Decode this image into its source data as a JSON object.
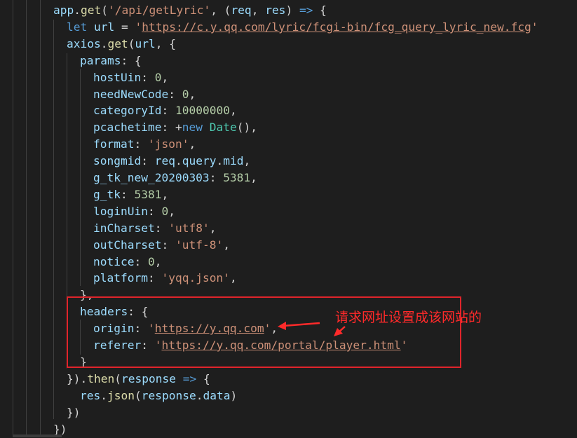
{
  "code_lines": [
    {
      "indent": 76,
      "tokens": [
        {
          "t": "app",
          "c": "var"
        },
        {
          "t": ".",
          "c": "pun"
        },
        {
          "t": "get",
          "c": "fn"
        },
        {
          "t": "(",
          "c": "pun"
        },
        {
          "t": "'/api/getLyric'",
          "c": "str"
        },
        {
          "t": ", (",
          "c": "pun"
        },
        {
          "t": "req",
          "c": "var"
        },
        {
          "t": ", ",
          "c": "pun"
        },
        {
          "t": "res",
          "c": "var"
        },
        {
          "t": ") ",
          "c": "pun"
        },
        {
          "t": "=>",
          "c": "kw"
        },
        {
          "t": " {",
          "c": "pun"
        }
      ]
    },
    {
      "indent": 95,
      "tokens": [
        {
          "t": "let",
          "c": "kw"
        },
        {
          "t": " ",
          "c": "pun"
        },
        {
          "t": "url",
          "c": "var"
        },
        {
          "t": " = ",
          "c": "pun"
        },
        {
          "t": "'",
          "c": "str"
        },
        {
          "t": "https://c.y.qq.com/lyric/fcgi-bin/fcg_query_lyric_new.fcg",
          "c": "str u"
        },
        {
          "t": "'",
          "c": "str"
        }
      ]
    },
    {
      "indent": 95,
      "tokens": [
        {
          "t": "axios",
          "c": "var"
        },
        {
          "t": ".",
          "c": "pun"
        },
        {
          "t": "get",
          "c": "fn"
        },
        {
          "t": "(",
          "c": "pun"
        },
        {
          "t": "url",
          "c": "var"
        },
        {
          "t": ", {",
          "c": "pun"
        }
      ]
    },
    {
      "indent": 114,
      "tokens": [
        {
          "t": "params",
          "c": "var"
        },
        {
          "t": ": {",
          "c": "pun"
        }
      ]
    },
    {
      "indent": 133,
      "tokens": [
        {
          "t": "hostUin",
          "c": "var"
        },
        {
          "t": ": ",
          "c": "pun"
        },
        {
          "t": "0",
          "c": "num"
        },
        {
          "t": ",",
          "c": "pun"
        }
      ]
    },
    {
      "indent": 133,
      "tokens": [
        {
          "t": "needNewCode",
          "c": "var"
        },
        {
          "t": ": ",
          "c": "pun"
        },
        {
          "t": "0",
          "c": "num"
        },
        {
          "t": ",",
          "c": "pun"
        }
      ]
    },
    {
      "indent": 133,
      "tokens": [
        {
          "t": "categoryId",
          "c": "var"
        },
        {
          "t": ": ",
          "c": "pun"
        },
        {
          "t": "10000000",
          "c": "num"
        },
        {
          "t": ",",
          "c": "pun"
        }
      ]
    },
    {
      "indent": 133,
      "tokens": [
        {
          "t": "pcachetime",
          "c": "var"
        },
        {
          "t": ": +",
          "c": "pun"
        },
        {
          "t": "new",
          "c": "kw"
        },
        {
          "t": " ",
          "c": "pun"
        },
        {
          "t": "Date",
          "c": "cls"
        },
        {
          "t": "(),",
          "c": "pun"
        }
      ]
    },
    {
      "indent": 133,
      "tokens": [
        {
          "t": "format",
          "c": "var"
        },
        {
          "t": ": ",
          "c": "pun"
        },
        {
          "t": "'json'",
          "c": "str"
        },
        {
          "t": ",",
          "c": "pun"
        }
      ]
    },
    {
      "indent": 133,
      "tokens": [
        {
          "t": "songmid",
          "c": "var"
        },
        {
          "t": ": ",
          "c": "pun"
        },
        {
          "t": "req",
          "c": "var"
        },
        {
          "t": ".",
          "c": "pun"
        },
        {
          "t": "query",
          "c": "var"
        },
        {
          "t": ".",
          "c": "pun"
        },
        {
          "t": "mid",
          "c": "var"
        },
        {
          "t": ",",
          "c": "pun"
        }
      ]
    },
    {
      "indent": 133,
      "tokens": [
        {
          "t": "g_tk_new_20200303",
          "c": "var"
        },
        {
          "t": ": ",
          "c": "pun"
        },
        {
          "t": "5381",
          "c": "num"
        },
        {
          "t": ",",
          "c": "pun"
        }
      ]
    },
    {
      "indent": 133,
      "tokens": [
        {
          "t": "g_tk",
          "c": "var"
        },
        {
          "t": ": ",
          "c": "pun"
        },
        {
          "t": "5381",
          "c": "num"
        },
        {
          "t": ",",
          "c": "pun"
        }
      ]
    },
    {
      "indent": 133,
      "tokens": [
        {
          "t": "loginUin",
          "c": "var"
        },
        {
          "t": ": ",
          "c": "pun"
        },
        {
          "t": "0",
          "c": "num"
        },
        {
          "t": ",",
          "c": "pun"
        }
      ]
    },
    {
      "indent": 133,
      "tokens": [
        {
          "t": "inCharset",
          "c": "var"
        },
        {
          "t": ": ",
          "c": "pun"
        },
        {
          "t": "'utf8'",
          "c": "str"
        },
        {
          "t": ",",
          "c": "pun"
        }
      ]
    },
    {
      "indent": 133,
      "tokens": [
        {
          "t": "outCharset",
          "c": "var"
        },
        {
          "t": ": ",
          "c": "pun"
        },
        {
          "t": "'utf-8'",
          "c": "str"
        },
        {
          "t": ",",
          "c": "pun"
        }
      ]
    },
    {
      "indent": 133,
      "tokens": [
        {
          "t": "notice",
          "c": "var"
        },
        {
          "t": ": ",
          "c": "pun"
        },
        {
          "t": "0",
          "c": "num"
        },
        {
          "t": ",",
          "c": "pun"
        }
      ]
    },
    {
      "indent": 133,
      "tokens": [
        {
          "t": "platform",
          "c": "var"
        },
        {
          "t": ": ",
          "c": "pun"
        },
        {
          "t": "'yqq.json'",
          "c": "str"
        },
        {
          "t": ",",
          "c": "pun"
        }
      ]
    },
    {
      "indent": 114,
      "tokens": [
        {
          "t": "},",
          "c": "pun"
        }
      ]
    },
    {
      "indent": 114,
      "tokens": [
        {
          "t": "headers",
          "c": "var"
        },
        {
          "t": ": {",
          "c": "pun"
        }
      ]
    },
    {
      "indent": 133,
      "tokens": [
        {
          "t": "origin",
          "c": "var"
        },
        {
          "t": ": ",
          "c": "pun"
        },
        {
          "t": "'",
          "c": "str"
        },
        {
          "t": "https://y.qq.com",
          "c": "str u"
        },
        {
          "t": "'",
          "c": "str"
        },
        {
          "t": ",",
          "c": "pun"
        }
      ]
    },
    {
      "indent": 133,
      "tokens": [
        {
          "t": "referer",
          "c": "var"
        },
        {
          "t": ": ",
          "c": "pun"
        },
        {
          "t": "'",
          "c": "str"
        },
        {
          "t": "https://y.qq.com/portal/player.html",
          "c": "str u"
        },
        {
          "t": "'",
          "c": "str"
        }
      ]
    },
    {
      "indent": 114,
      "tokens": [
        {
          "t": "}",
          "c": "pun"
        }
      ]
    },
    {
      "indent": 95,
      "tokens": [
        {
          "t": "}).",
          "c": "pun"
        },
        {
          "t": "then",
          "c": "fn"
        },
        {
          "t": "(",
          "c": "pun"
        },
        {
          "t": "response",
          "c": "var"
        },
        {
          "t": " ",
          "c": "pun"
        },
        {
          "t": "=>",
          "c": "kw"
        },
        {
          "t": " {",
          "c": "pun"
        }
      ]
    },
    {
      "indent": 114,
      "tokens": [
        {
          "t": "res",
          "c": "var"
        },
        {
          "t": ".",
          "c": "pun"
        },
        {
          "t": "json",
          "c": "fn"
        },
        {
          "t": "(",
          "c": "pun"
        },
        {
          "t": "response",
          "c": "var"
        },
        {
          "t": ".",
          "c": "pun"
        },
        {
          "t": "data",
          "c": "var"
        },
        {
          "t": ")",
          "c": "pun"
        }
      ]
    },
    {
      "indent": 95,
      "tokens": [
        {
          "t": "})",
          "c": "pun"
        }
      ]
    },
    {
      "indent": 76,
      "tokens": [
        {
          "t": "})",
          "c": "pun"
        }
      ]
    }
  ],
  "annotation": {
    "text": "请求网址设置成该网站的",
    "color": "#ff2a2a"
  },
  "theme": {
    "background": "#1e1e1e",
    "annotation_box_color": "#e0242b"
  }
}
